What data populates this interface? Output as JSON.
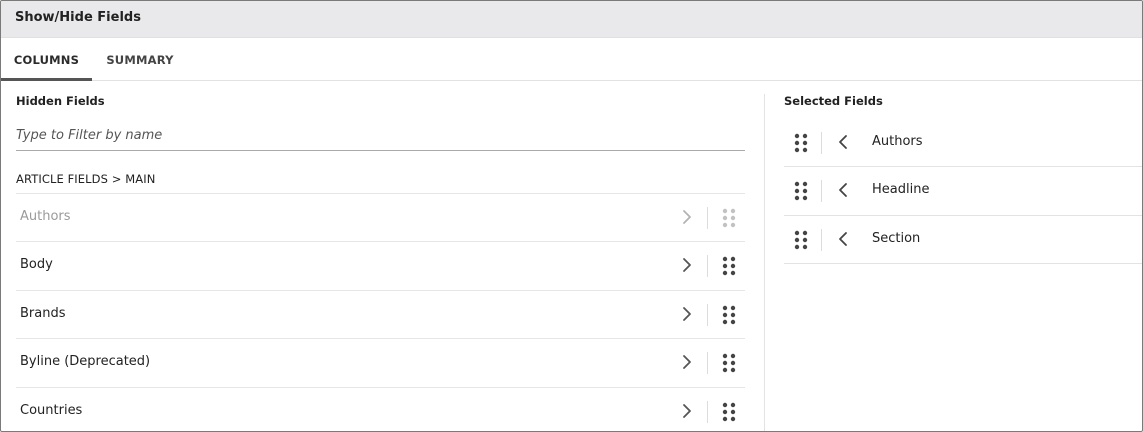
{
  "dialog": {
    "title": "Show/Hide Fields"
  },
  "tabs": [
    {
      "label": "COLUMNS",
      "active": true
    },
    {
      "label": "SUMMARY",
      "active": false
    }
  ],
  "hidden": {
    "heading": "Hidden Fields",
    "filter_placeholder": "Type to Filter by name",
    "filter_value": "",
    "group_label": "ARTICLE FIELDS > MAIN",
    "items": [
      {
        "label": "Authors",
        "disabled": true
      },
      {
        "label": "Body",
        "disabled": false
      },
      {
        "label": "Brands",
        "disabled": false
      },
      {
        "label": "Byline (Deprecated)",
        "disabled": false
      },
      {
        "label": "Countries",
        "disabled": false
      }
    ]
  },
  "selected": {
    "heading": "Selected Fields",
    "items": [
      {
        "label": "Authors"
      },
      {
        "label": "Headline"
      },
      {
        "label": "Section"
      }
    ]
  },
  "icons": {
    "move_right": "chevron-right-icon",
    "move_left": "chevron-left-icon",
    "drag": "drag-handle-icon"
  },
  "colors": {
    "header_bg": "#e9e8eb",
    "active_tab_underline": "#555555",
    "disabled_text": "#9a9a9a",
    "text": "#222222"
  }
}
